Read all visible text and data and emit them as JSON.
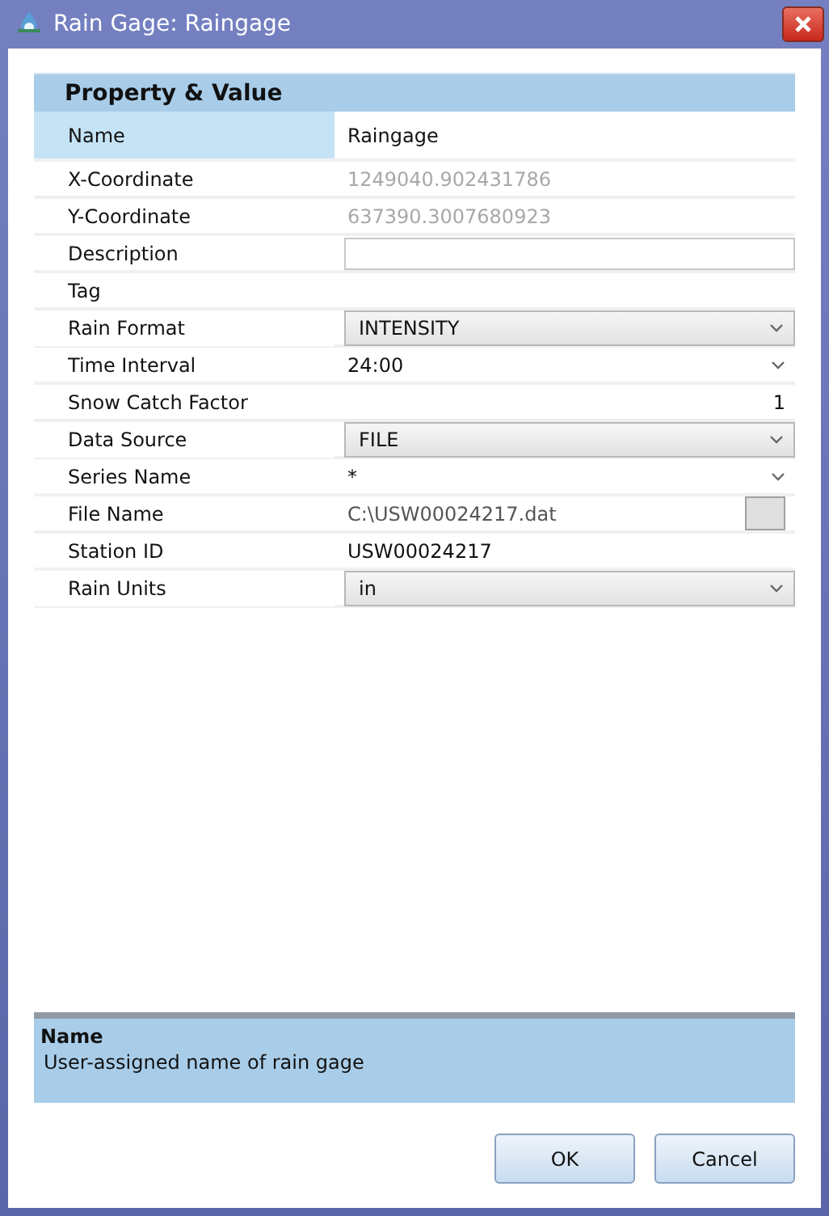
{
  "window": {
    "title": "Rain Gage: Raingage"
  },
  "grid": {
    "header": "Property & Value",
    "rows": [
      {
        "label": "Name",
        "value": "Raingage",
        "kind": "text",
        "selected": true
      },
      {
        "label": "X-Coordinate",
        "value": "1249040.902431786",
        "kind": "readonly",
        "selected": false
      },
      {
        "label": "Y-Coordinate",
        "value": "637390.3007680923",
        "kind": "readonly",
        "selected": false
      },
      {
        "label": "Description",
        "kind": "input",
        "selected": false
      },
      {
        "label": "Tag",
        "kind": "text",
        "selected": false
      },
      {
        "label": "Rain Format",
        "value": "INTENSITY",
        "kind": "combo",
        "selected": false
      },
      {
        "label": "Time Interval",
        "value": "24:00",
        "kind": "list",
        "selected": false
      },
      {
        "label": "Snow Catch Factor",
        "value": "1",
        "kind": "number",
        "selected": false
      },
      {
        "label": "Data Source",
        "value": "FILE",
        "kind": "combo",
        "selected": false
      },
      {
        "label": "Series Name",
        "value": "*",
        "kind": "list",
        "selected": false
      },
      {
        "label": "File Name",
        "value": "C:\\USW00024217.dat",
        "kind": "file",
        "selected": false
      },
      {
        "label": "Station ID",
        "value": "USW00024217",
        "kind": "text",
        "selected": false
      },
      {
        "label": "Rain Units",
        "value": "in",
        "kind": "combo",
        "selected": false
      }
    ]
  },
  "description": {
    "title": "Name",
    "text": "User-assigned name of rain gage"
  },
  "buttons": [
    "OK",
    "Cancel"
  ]
}
